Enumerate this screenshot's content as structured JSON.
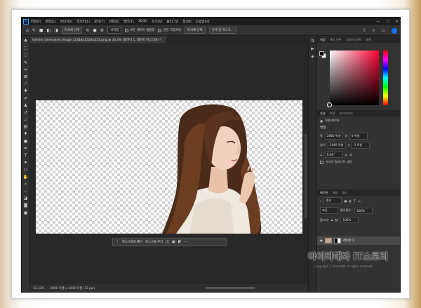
{
  "menu": [
    "파일(F)",
    "편집(E)",
    "이미지(I)",
    "레이어(L)",
    "문자(Y)",
    "선택(S)",
    "필터(T)",
    "3D(D)",
    "보기(V)",
    "플러그인",
    "창(W)",
    "도움말(H)"
  ],
  "options": {
    "select_subject": "피사체 선택",
    "mode": "사각형",
    "sample_all_layers": "모든 레이어 샘플링",
    "enhance_edge": "강한 가장자리",
    "auto_select": "피사체 선택",
    "select_and_mask": "선택 및 마스크..."
  },
  "document": {
    "tab_title": "Gemini_Generated_Image_c232jkc232jkc232.png @ 33.3% (레이어 1, 레이어 마스크/8) *"
  },
  "context_bar": {
    "subtract_label": "마스크에서 빼기",
    "add_label": "마스크에 추가"
  },
  "status": {
    "zoom": "33.33%",
    "size": "2880 픽셀 x 1440 픽셀 (72 ppi)"
  },
  "panels": {
    "color_tabs": [
      "색상",
      "색상 견본",
      "그레이디언트",
      "패턴"
    ],
    "props_tabs": [
      "속성",
      "조정",
      "라이브러리"
    ],
    "props_type": "픽셀 레이어",
    "transform_head": "변형",
    "width_label": "폭",
    "width_value": "2880 픽셀",
    "height_label": "높이",
    "height_value": "1440 픽셀",
    "x_label": "X",
    "x_value": "0 픽셀",
    "y_label": "Y",
    "y_value": "0 픽셀",
    "angle_value": "0.00°",
    "smart_label": "실시간 컴퍼넌트 사용",
    "layers_tabs": [
      "레이어",
      "채널",
      "패스"
    ],
    "search_label": "종류",
    "blend_mode": "표준",
    "opacity_label": "불투명도:",
    "opacity_value": "100%",
    "lock_label": "잠그기:",
    "fill_label": "칠:",
    "fill_value": "100%",
    "layer_name": "레이어 1"
  },
  "watermark": {
    "title": "아이티해봐 IT스토리",
    "subtitle": "Copyright ⓒ 아이티해봐 All rights reserved."
  },
  "colors": {
    "accent": "#1473e6",
    "panel_bg": "#323232",
    "canvas_bg": "#282828"
  }
}
